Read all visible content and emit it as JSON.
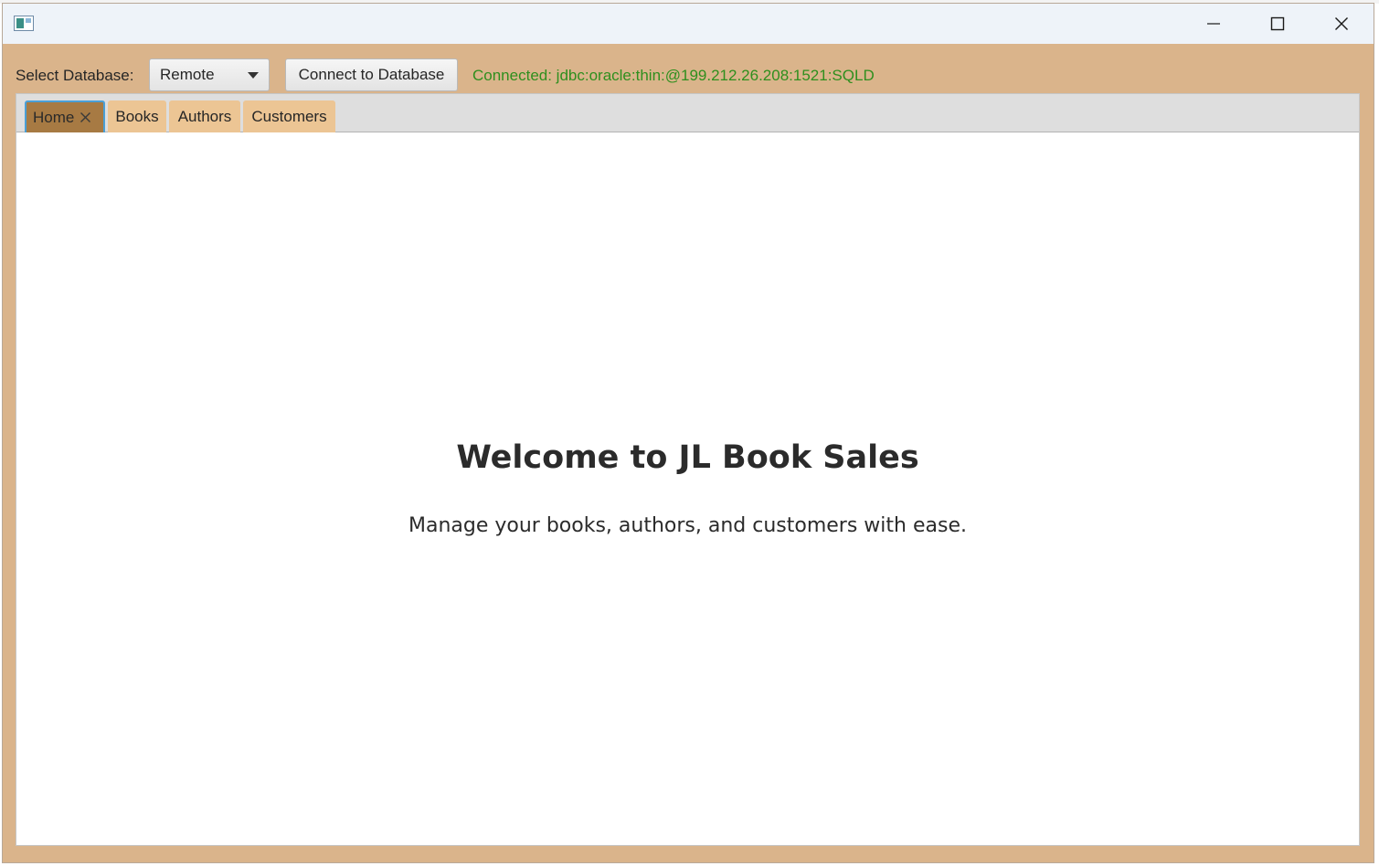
{
  "window": {
    "icon": "app-window-icon",
    "controls": [
      "minimize-icon",
      "maximize-icon",
      "close-icon"
    ]
  },
  "toolbar": {
    "db_label": "Select Database:",
    "db_select_value": "Remote",
    "connect_label": "Connect to Database",
    "status": "Connected: jdbc:oracle:thin:@199.212.26.208:1521:SQLD",
    "status_color": "#2f8f1e"
  },
  "tabs": [
    {
      "label": "Home",
      "selected": true,
      "closable": true
    },
    {
      "label": "Books"
    },
    {
      "label": "Authors"
    },
    {
      "label": "Customers"
    }
  ],
  "home": {
    "title": "Welcome to JL Book Sales",
    "subtitle": "Manage your books, authors, and customers with ease."
  },
  "colors": {
    "frame": "#dab48b",
    "tab": "#ecc594",
    "tab_selected": "#a77a43",
    "focus": "#4a9fd6"
  }
}
